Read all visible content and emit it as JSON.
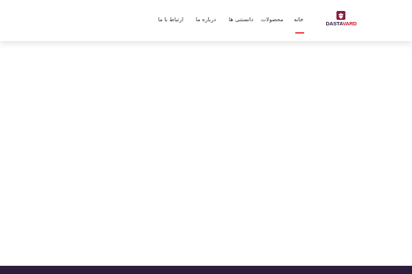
{
  "brand": {
    "logo_text_1": "DASTA",
    "logo_text_2": "VARD",
    "logo_icon": "acorn-icon",
    "colors": {
      "dark": "#2c1838",
      "accent": "#c8102e"
    }
  },
  "nav": {
    "items": [
      {
        "label": "خانه",
        "active": true
      },
      {
        "label": "محصولات",
        "active": false
      },
      {
        "label": "دانستنی ها",
        "active": false
      },
      {
        "label": "درباره ما",
        "active": false
      },
      {
        "label": "ارتباط با ما",
        "active": false
      }
    ],
    "active_color": "#e53935"
  },
  "footer": {
    "background": "#2d1d3d"
  }
}
